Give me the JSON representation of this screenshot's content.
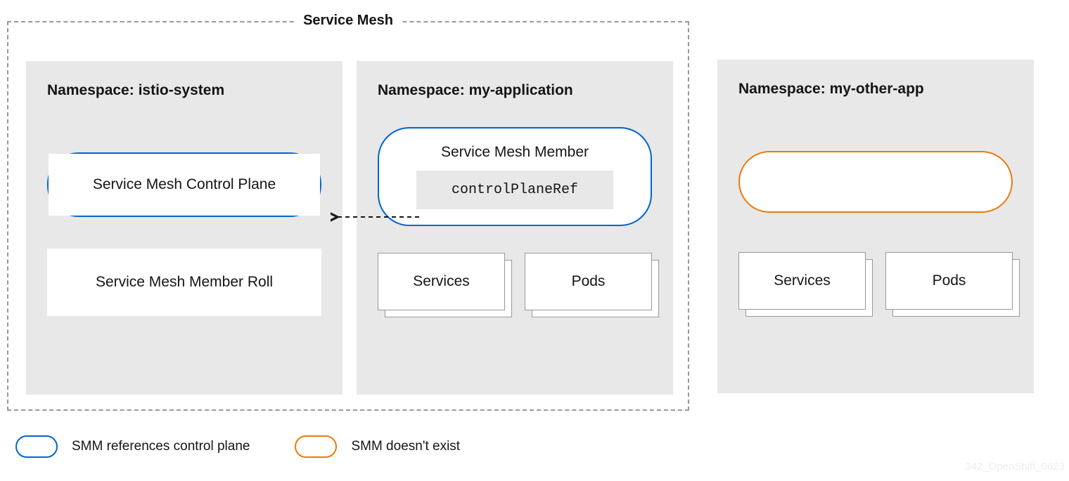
{
  "mesh_title": "Service Mesh",
  "namespaces": {
    "ns1": {
      "label": "Namespace: istio-system"
    },
    "ns2": {
      "label": "Namespace: my-application"
    },
    "ns3": {
      "label": "Namespace:  my-other-app"
    }
  },
  "smcp_label": "Service Mesh Control Plane",
  "smm_label": "Service Mesh Member",
  "ref_label": "controlPlaneRef",
  "member_roll_label": "Service Mesh Member Roll",
  "services_label": "Services",
  "pods_label": "Pods",
  "legend": {
    "blue": "SMM references control plane",
    "orange": "SMM doesn't exist"
  },
  "watermark": "342_OpenShift_0623",
  "colors": {
    "blue": "#0066cc",
    "orange": "#ec7a08",
    "gray_bg": "#e8e8e8",
    "border_gray": "#999"
  }
}
